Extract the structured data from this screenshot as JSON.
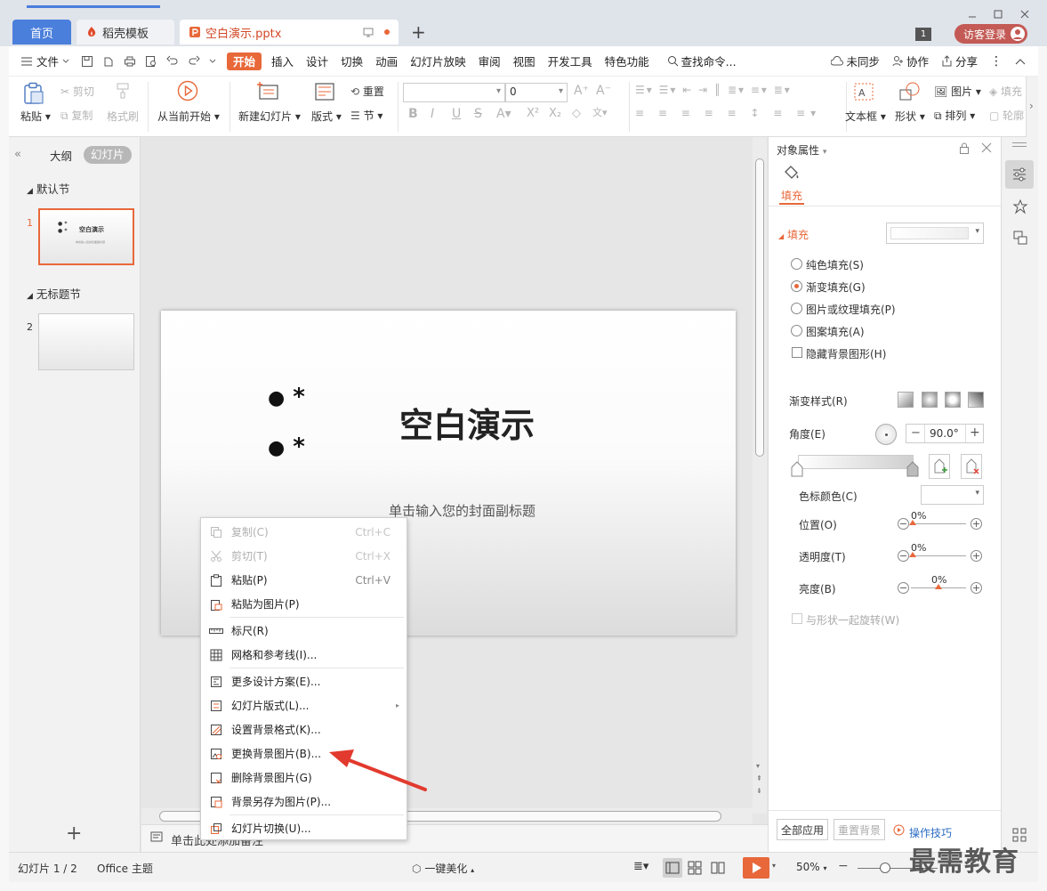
{
  "tabs": [
    {
      "label": "首页"
    },
    {
      "label": "稻壳模板"
    },
    {
      "label": "空白演示.pptx"
    }
  ],
  "window": {
    "badge": "1",
    "login_label": "访客登录"
  },
  "menubar": {
    "file_label": "文件",
    "items": [
      "开始",
      "插入",
      "设计",
      "切换",
      "动画",
      "幻灯片放映",
      "审阅",
      "视图",
      "开发工具",
      "特色功能"
    ],
    "search_label": "查找命令...",
    "right_items": [
      "未同步",
      "协作",
      "分享"
    ]
  },
  "ribbon": {
    "paste": "粘贴",
    "cut": "剪切",
    "copy": "复制",
    "format_painter": "格式刷",
    "from_start": "从当前开始",
    "new_slide": "新建幻灯片",
    "layout": "版式",
    "reset": "重置",
    "section": "节",
    "font_size": "0",
    "textbox": "文本框",
    "shape": "形状",
    "picture": "图片",
    "arrange": "排列",
    "fill": "填充",
    "outline": "轮廓"
  },
  "leftpanel": {
    "tab_outline": "大纲",
    "tab_slides": "幻灯片",
    "section1": "默认节",
    "section2": "无标题节",
    "slide1_num": "1",
    "slide2_num": "2",
    "thumb_title": "空白演示",
    "thumb_subtitle": "单击输入您的封面副标题"
  },
  "slide": {
    "title": "空白演示",
    "subtitle": "单击输入您的封面副标题",
    "bullet_mark": "*"
  },
  "context_menu": [
    {
      "label": "复制(C)",
      "shortcut": "Ctrl+C",
      "disabled": true
    },
    {
      "label": "剪切(T)",
      "shortcut": "Ctrl+X",
      "disabled": true
    },
    {
      "label": "粘贴(P)",
      "shortcut": "Ctrl+V",
      "disabled": false
    },
    {
      "label": "粘贴为图片(P)",
      "shortcut": "",
      "disabled": false
    },
    {
      "label": "标尺(R)",
      "shortcut": "",
      "disabled": false
    },
    {
      "label": "网格和参考线(I)...",
      "shortcut": "",
      "disabled": false
    },
    {
      "label": "更多设计方案(E)...",
      "shortcut": "",
      "disabled": false
    },
    {
      "label": "幻灯片版式(L)...",
      "shortcut": "",
      "disabled": false
    },
    {
      "label": "设置背景格式(K)...",
      "shortcut": "",
      "disabled": false
    },
    {
      "label": "更换背景图片(B)...",
      "shortcut": "",
      "disabled": false
    },
    {
      "label": "删除背景图片(G)",
      "shortcut": "",
      "disabled": false
    },
    {
      "label": "背景另存为图片(P)...",
      "shortcut": "",
      "disabled": false
    },
    {
      "label": "幻灯片切换(U)...",
      "shortcut": "",
      "disabled": false
    }
  ],
  "rightpanel": {
    "header": "对象属性",
    "tab": "填充",
    "section": "填充",
    "options": [
      "纯色填充(S)",
      "渐变填充(G)",
      "图片或纹理填充(P)",
      "图案填充(A)"
    ],
    "hide_bg": "隐藏背景图形(H)",
    "gradient_style": "渐变样式(R)",
    "angle_label": "角度(E)",
    "angle_value": "90.0°",
    "stop_color": "色标颜色(C)",
    "position_label": "位置(O)",
    "position_value": "0%",
    "transparency_label": "透明度(T)",
    "transparency_value": "0%",
    "brightness_label": "亮度(B)",
    "brightness_value": "0%",
    "rotate_with_shape": "与形状一起旋转(W)",
    "apply_all": "全部应用",
    "reset_bg": "重置背景",
    "tips": "操作技巧"
  },
  "notebar": {
    "placeholder": "单击此处添加备注"
  },
  "statusbar": {
    "slide_count": "幻灯片 1 / 2",
    "theme": "Office 主题",
    "beautify": "一键美化",
    "zoom": "50%"
  },
  "watermark": "最需教育",
  "colors": {
    "accent": "#e8683a",
    "home_tab": "#4a7fdc",
    "login": "#c35a55",
    "tips_link": "#2b6cc4"
  }
}
